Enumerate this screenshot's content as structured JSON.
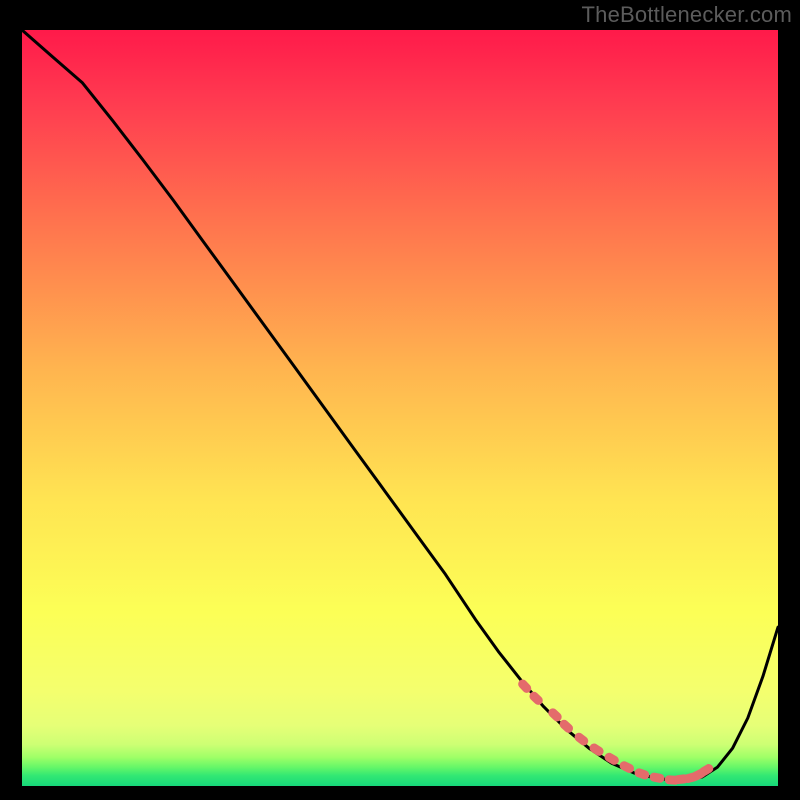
{
  "watermark": "TheBottlenecker.com",
  "colors": {
    "frame": "#000000",
    "gradient_top": "#ff1a4a",
    "gradient_mid_upper": "#ff714e",
    "gradient_mid": "#ffc94f",
    "gradient_low": "#fcff58",
    "gradient_near_bottom": "#f1ff76",
    "gradient_green1": "#9dff5e",
    "gradient_green2": "#36f06e",
    "gradient_bottom": "#17d97a",
    "curve": "#000000",
    "markers": "#e46b6b"
  },
  "chart_data": {
    "type": "line",
    "title": "",
    "xlabel": "",
    "ylabel": "",
    "xlim": [
      0,
      100
    ],
    "ylim": [
      0,
      100
    ],
    "x": [
      0,
      4,
      8,
      12,
      16,
      20,
      24,
      28,
      32,
      36,
      40,
      44,
      48,
      52,
      56,
      60,
      63,
      66,
      69,
      72,
      75,
      78,
      81,
      84,
      86,
      88,
      90,
      92,
      94,
      96,
      98,
      100
    ],
    "y": [
      100,
      96.5,
      93,
      88,
      82.8,
      77.5,
      72,
      66.5,
      61,
      55.5,
      50,
      44.5,
      39,
      33.5,
      28,
      22,
      17.8,
      14,
      10.5,
      7.5,
      5,
      3,
      1.7,
      1.0,
      0.8,
      0.8,
      1.2,
      2.5,
      5,
      9,
      14.5,
      21
    ],
    "markers_x": [
      66.5,
      68,
      70.5,
      72,
      74,
      76,
      78,
      80,
      82,
      84,
      86,
      87.2,
      88.5,
      89.5,
      90.5
    ],
    "markers_y": [
      13.2,
      11.6,
      9.4,
      7.9,
      6.2,
      4.8,
      3.6,
      2.5,
      1.6,
      1.1,
      0.8,
      0.9,
      1.1,
      1.5,
      2.1
    ]
  }
}
